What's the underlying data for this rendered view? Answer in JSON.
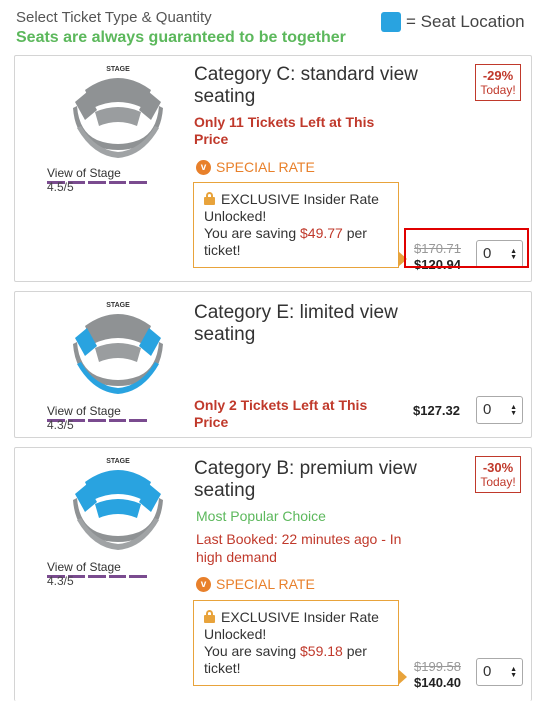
{
  "header": {
    "title": "Select Ticket Type & Quantity",
    "subtitle": "Seats are always guaranteed to be together",
    "legend_label": "= Seat Location",
    "legend_color": "#29a3e0"
  },
  "colors": {
    "urgent": "#c0392b",
    "special": "#e8802b",
    "popular": "#5cb85c",
    "rating": "#7a4b8f"
  },
  "cards": [
    {
      "stage_label": "STAGE",
      "title": "Category C: standard view seating",
      "discount": "-29%",
      "discount_sub": "Today!",
      "urgency": "Only 11 Tickets Left at This Price",
      "special": "SPECIAL RATE",
      "insider_line1": "EXCLUSIVE Insider Rate Unlocked!",
      "insider_line2_prefix": "You are saving ",
      "insider_saving": "$49.77",
      "insider_line2_suffix": " per ticket!",
      "old_price": "$170.71",
      "price": "$120.94",
      "quantity": "0",
      "view_label": "View of Stage",
      "rating": "4.5/5"
    },
    {
      "stage_label": "STAGE",
      "title": "Category E: limited view seating",
      "urgency": "Only 2 Tickets Left at This Price",
      "price": "$127.32",
      "quantity": "0",
      "view_label": "View of Stage",
      "rating": "4.3/5"
    },
    {
      "stage_label": "STAGE",
      "title": "Category B: premium view seating",
      "discount": "-30%",
      "discount_sub": "Today!",
      "popular": "Most Popular Choice",
      "booked": "Last Booked: 22 minutes ago - In high demand",
      "special": "SPECIAL RATE",
      "insider_line1": "EXCLUSIVE Insider Rate Unlocked!",
      "insider_line2_prefix": "You are saving ",
      "insider_saving": "$59.18",
      "insider_line2_suffix": " per ticket!",
      "old_price": "$199.58",
      "price": "$140.40",
      "quantity": "0",
      "view_label": "View of Stage",
      "rating": "4.3/5"
    }
  ]
}
